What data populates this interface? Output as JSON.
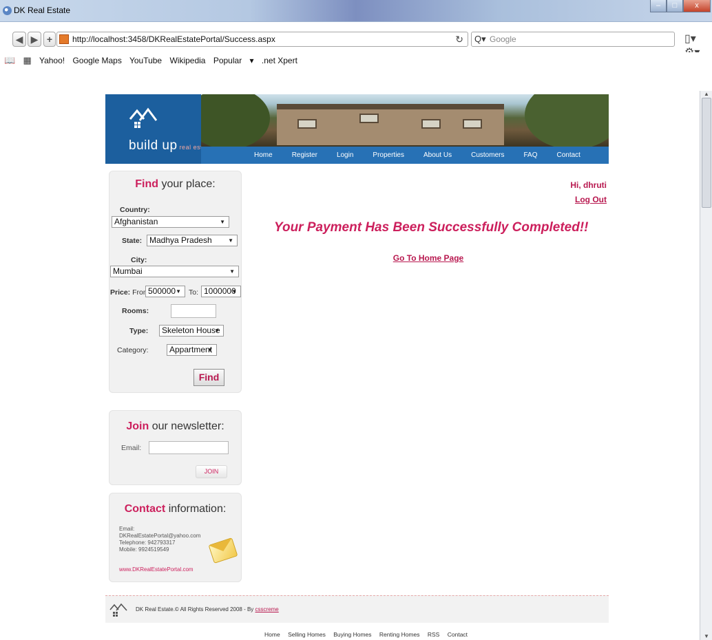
{
  "window": {
    "title": "DK Real Estate"
  },
  "browser": {
    "url": "http://localhost:3458/DKRealEstatePortal/Success.aspx",
    "search_placeholder": "Google",
    "bookmarks": [
      "Yahoo!",
      "Google Maps",
      "YouTube",
      "Wikipedia",
      "Popular",
      ".net Xpert"
    ]
  },
  "site": {
    "logo_text": "build up",
    "logo_sub": "real estate",
    "menu": [
      "Home",
      "Register",
      "Login",
      "Properties",
      "About Us",
      "Customers",
      "FAQ",
      "Contact"
    ]
  },
  "find": {
    "title_bold": "Find",
    "title_rest": " your place:",
    "country_label": "Country:",
    "country_value": "Afghanistan",
    "state_label": "State:",
    "state_value": "Madhya Pradesh",
    "city_label": "City:",
    "city_value": "Mumbai",
    "price_label": "Price:",
    "from_label": "From:",
    "price_from": "500000",
    "to_label": "To:",
    "price_to": "1000000",
    "rooms_label": "Rooms:",
    "type_label": "Type:",
    "type_value": "Skeleton House",
    "category_label": "Category:",
    "category_value": "Appartment",
    "button": "Find"
  },
  "newsletter": {
    "title_bold": "Join",
    "title_rest": " our newsletter:",
    "email_label": "Email:",
    "button": "JOIN"
  },
  "contact": {
    "title_bold": "Contact",
    "title_rest": " information:",
    "email_label": "Email:",
    "email": "DKRealEstatePortal@yahoo.com",
    "telephone": "Telephone: 942793317",
    "mobile": "Mobile: 9924519549",
    "website": "www.DKRealEstatePortal.com"
  },
  "main": {
    "greeting": "Hi, dhruti",
    "logout": "Log Out",
    "message": "Your Payment Has Been Successfully Completed!!",
    "home_link": "Go To Home Page"
  },
  "footer": {
    "copyright": "DK Real Estate.© All Rights Reserved 2008 - By ",
    "credit": "csscreme",
    "links": [
      "Home",
      "Selling Homes",
      "Buying Homes",
      "Renting Homes",
      "RSS",
      "Contact"
    ]
  }
}
